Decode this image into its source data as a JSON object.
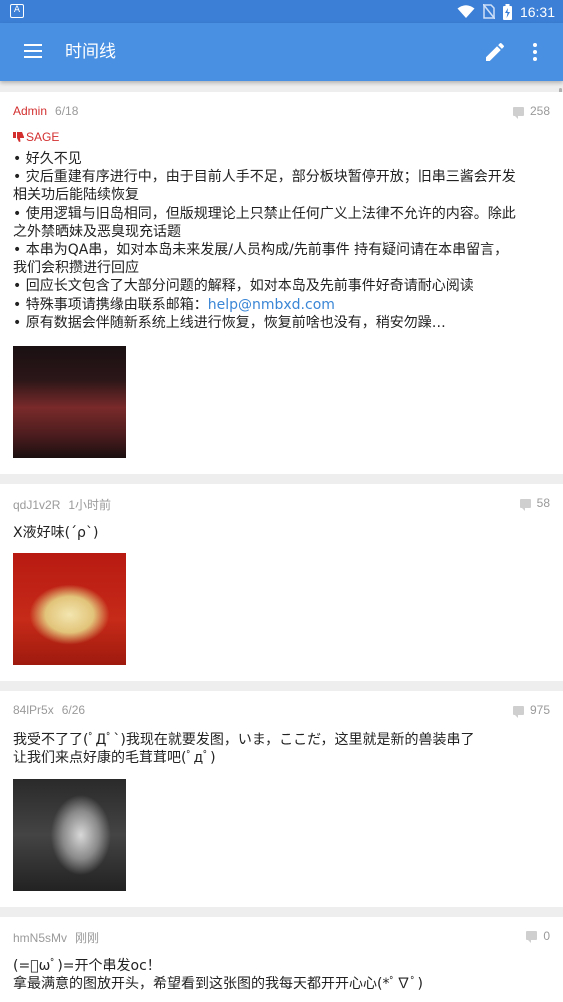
{
  "status_bar": {
    "left_icon": "A",
    "time": "16:31",
    "icons": [
      "wifi-icon",
      "no-sim-icon",
      "battery-charging-icon"
    ]
  },
  "toolbar": {
    "title": "时间线",
    "menu_icon": "hamburger-menu-icon",
    "edit_icon": "pencil-icon",
    "more_icon": "more-vert-icon"
  },
  "colors": {
    "status_bar": "#3b7fd6",
    "toolbar": "#4a90e2",
    "admin_red": "#d32f2f",
    "link": "#3a86d6"
  },
  "posts": [
    {
      "uid": "Admin",
      "time": "6/18",
      "replies": "258",
      "sage": "SAGE",
      "lines": [
        "• 好久不见",
        "• 灾后重建有序进行中，由于目前人手不足，部分板块暂停开放；旧串三酱会开发",
        "相关功后能陆续恢复",
        "• 使用逻辑与旧岛相同，但版规理论上只禁止任何广义上法律不允许的内容。除此",
        "之外禁晒妹及恶臭现充话题",
        "• 本串为QA串，如对本岛未来发展/人员构成/先前事件 持有疑问请在本串留言，",
        "我们会积攒进行回应",
        "• 回应长文包含了大部分问题的解释，如对本岛及先前事件好奇请耐心阅读"
      ],
      "email_prefix": "• 特殊事项请携缘由联系邮箱：",
      "email": "help@nmbxd.com",
      "last_line": "• 原有数据会伴随新系统上线进行恢复，恢复前啥也没有，稍安勿躁…"
    },
    {
      "uid": "qdJ1v2R",
      "time": "1小时前",
      "replies": "58",
      "lines": [
        "X液好味(´ρ`)"
      ]
    },
    {
      "uid": "84lPr5x",
      "time": "6/26",
      "replies": "975",
      "lines": [
        "我受不了了(ﾟДﾟ`)我现在就要发图，いま，ここだ，这里就是新的兽装串了",
        "让我们来点好康的毛茸茸吧(ﾟдﾟ)"
      ]
    },
    {
      "uid": "hmN5sMv",
      "time": "刚刚",
      "replies": "0",
      "lines": [
        "(=ﾟωﾟ)=开个串发oc！",
        "拿最满意的图放开头，希望看到这张图的我每天都开开心心(*ﾟ∇ﾟ)"
      ]
    }
  ]
}
